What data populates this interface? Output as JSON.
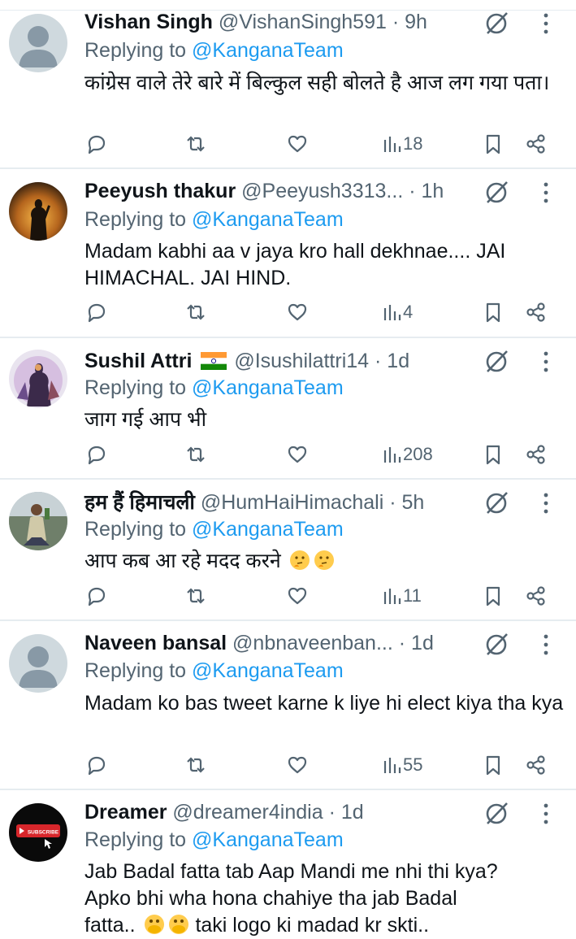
{
  "reply_prefix": "Replying to",
  "tweets": [
    {
      "name": "Vishan Singh",
      "handle": "@VishanSingh591",
      "sep": "·",
      "time": "9h",
      "reply_to": "@KanganaTeam",
      "text": "कांग्रेस वाले तेरे बारे में बिल्कुल सही बोलते है आज लग गया पता।",
      "views": "18",
      "avatar": "default"
    },
    {
      "name": "Peeyush thakur",
      "handle": "@Peeyush3313...",
      "sep": "·",
      "time": "1h",
      "reply_to": "@KanganaTeam",
      "text": "Madam kabhi aa v jaya kro hall dekhnae.... JAI HIMACHAL. JAI HIND.",
      "views": "4",
      "avatar": "silhouette-sunset"
    },
    {
      "name": "Sushil Attri",
      "handle": "@Isushilattri14",
      "sep": "·",
      "time": "1d",
      "reply_to": "@KanganaTeam",
      "text": "जाग गई आप भी",
      "views": "208",
      "avatar": "figure-art",
      "flag": "india-flag"
    },
    {
      "name": "हम हैं हिमाचली",
      "handle": "@HumHaiHimachali",
      "sep": "·",
      "time": "5h",
      "reply_to": "@KanganaTeam",
      "text": "आप कब आ रहे मदद करने",
      "emoji": [
        "thinking-face",
        "thinking-face"
      ],
      "views": "11",
      "avatar": "person-outdoor"
    },
    {
      "name": "Naveen bansal",
      "handle": "@nbnaveenban...",
      "sep": "·",
      "time": "1d",
      "reply_to": "@KanganaTeam",
      "text": "Madam ko bas tweet karne k liye hi elect kiya tha kya",
      "views": "55",
      "avatar": "default"
    },
    {
      "name": "Dreamer",
      "handle": "@dreamer4india",
      "sep": "·",
      "time": "1d",
      "reply_to": "@KanganaTeam",
      "text_line1": "Jab Badal fatta tab Aap Mandi me nhi thi kya?",
      "text_line2": "Apko bhi wha hona chahiye tha jab Badal",
      "text_line3a": "fatta..",
      "text_line3b": "taki logo ki madad kr skti..",
      "emoji": [
        "face-with-open-eyes-and-hand-over-mouth",
        "face-with-open-eyes-and-hand-over-mouth"
      ],
      "avatar": "subscribe-logo",
      "avatar_text": "SUBSCRIBE"
    }
  ],
  "colors": {
    "text": "#0f1419",
    "secondary": "#536471",
    "link": "#1d9bf0",
    "divider": "#e6ecf0"
  }
}
